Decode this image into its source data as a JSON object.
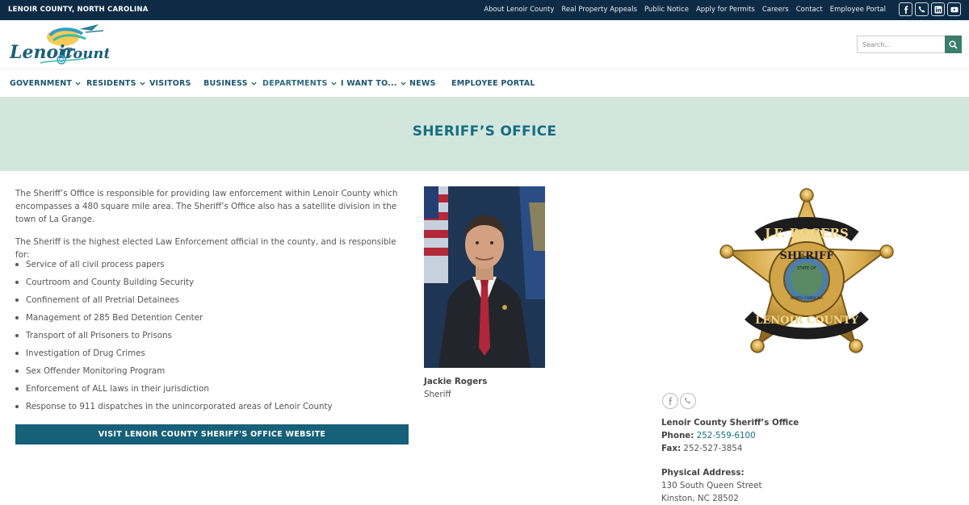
{
  "topbar": {
    "county": "LENOIR COUNTY, NORTH CAROLINA",
    "links": [
      "About Lenoir County",
      "Real Property Appeals",
      "Public Notice",
      "Apply for Permits",
      "Careers",
      "Contact",
      "Employee Portal"
    ],
    "social_icons": [
      "facebook-icon",
      "phone-icon",
      "linkedin-icon",
      "youtube-icon"
    ]
  },
  "header": {
    "logo_text_1": "Lenoir",
    "logo_text_2": "County",
    "search_placeholder": "Search..."
  },
  "nav": {
    "items": [
      {
        "label": "GOVERNMENT",
        "dropdown": true
      },
      {
        "label": "RESIDENTS",
        "dropdown": true
      },
      {
        "label": "VISITORS",
        "dropdown": false
      },
      {
        "label": "BUSINESS",
        "dropdown": true
      },
      {
        "label": "DEPARTMENTS",
        "dropdown": true
      },
      {
        "label": "I WANT TO...",
        "dropdown": true
      },
      {
        "label": "NEWS",
        "dropdown": false
      },
      {
        "label": "EMPLOYEE PORTAL",
        "dropdown": false
      }
    ]
  },
  "page": {
    "title": "SHERIFF’S OFFICE",
    "intro": "The Sheriff’s Office is responsible for providing law enforcement within Lenoir County which encompasses a 480 square mile area. The Sheriff’s Office also has a satellite division in the town of La Grange.",
    "responsibilities_intro": "The Sheriff is the highest elected Law Enforcement official in the county, and is responsible for:",
    "responsibilities": [
      "Service of all civil process papers",
      "Courtroom and County Building Security",
      "Confinement of all Pretrial Detainees",
      "Management of 285 Bed Detention Center",
      "Transport of all Prisoners to Prisons",
      "Investigation of Drug Crimes",
      "Sex Offender Monitoring Program",
      "Enforcement of ALL laws in their jurisdiction",
      "Response to 911 dispatches in the unincorporated areas of Lenoir County"
    ],
    "visit_button": "VISIT LENOIR COUNTY SHERIFF'S OFFICE WEBSITE"
  },
  "sheriff": {
    "name": "Jackie Rogers",
    "title": "Sheriff"
  },
  "badge": {
    "top_text": "J.F. ROGERS",
    "middle_text": "SHERIFF",
    "bottom_text": "LENOIR COUNTY",
    "seal_top": "STATE OF",
    "seal_bottom": "NORTH CAROLINA"
  },
  "contact": {
    "social_icons": [
      "facebook-icon",
      "phone-icon"
    ],
    "office_name": "Lenoir County Sheriff’s Office",
    "phone_label": "Phone:",
    "phone": "252-559-6100",
    "fax_label": "Fax:",
    "fax": "252-527-3854",
    "address_label": "Physical Address:",
    "address_line1": "130 South Queen Street",
    "address_line2": "Kinston, NC 28502"
  }
}
